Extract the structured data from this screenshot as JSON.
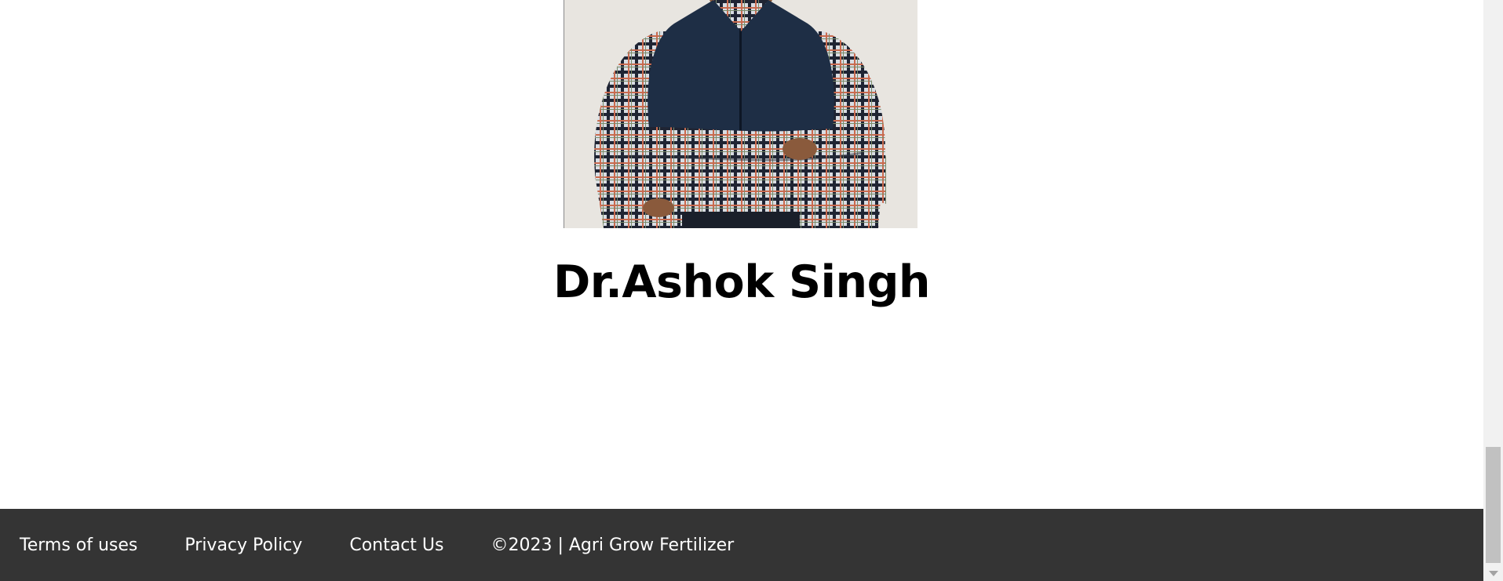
{
  "profile": {
    "name": "Dr.Ashok Singh",
    "photo_icon": "person-photo"
  },
  "footer": {
    "links": [
      "Terms of uses",
      "Privacy Policy",
      "Contact Us"
    ],
    "copyright": "©2023 | Agri Grow Fertilizer",
    "background_color": "#343434"
  },
  "scrollbar": {
    "scroll_position_fraction": 0.95
  }
}
